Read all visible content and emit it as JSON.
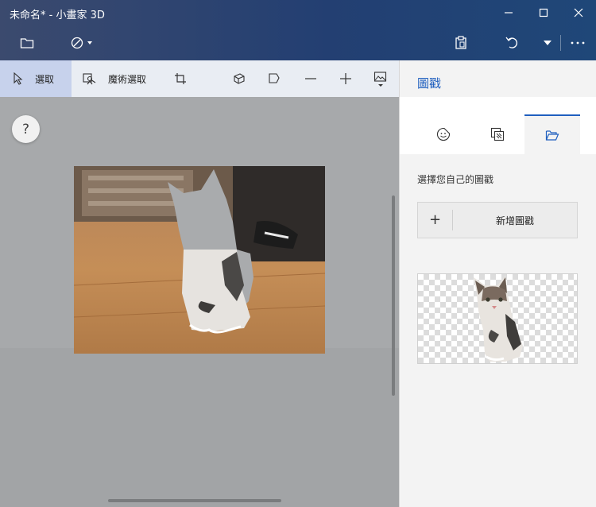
{
  "window": {
    "title": "未命名* - 小畫家 3D"
  },
  "toolbar": {
    "select_label": "選取",
    "magic_select_label": "魔術選取"
  },
  "canvas": {
    "help_label": "?"
  },
  "panel": {
    "title": "圖戳",
    "select_own_label": "選擇您自己的圖戳",
    "add_symbol": "+",
    "new_sticker_label": "新增圖戳"
  },
  "colors": {
    "accent": "#1f5fbf",
    "header_start": "#3b4a6e",
    "header_end": "#1f4778",
    "toolbar_bg": "#e9edf3",
    "active_tool_bg": "#c7d2ec",
    "canvas_bg": "#a7a9ab"
  },
  "icons": {
    "window": [
      "minimize-icon",
      "maximize-icon",
      "close-icon"
    ],
    "header": [
      "folder-icon",
      "brush-icon",
      "paste-icon",
      "undo-icon",
      "more-icon"
    ],
    "tools": [
      "select-arrow-icon",
      "magic-select-icon",
      "crop-icon",
      "3d-view-icon",
      "flag-icon",
      "zoom-out-icon",
      "zoom-in-icon",
      "image-icon"
    ],
    "panel_tabs": [
      "sticker-emoji-icon",
      "texture-icon",
      "folder-open-icon"
    ]
  }
}
